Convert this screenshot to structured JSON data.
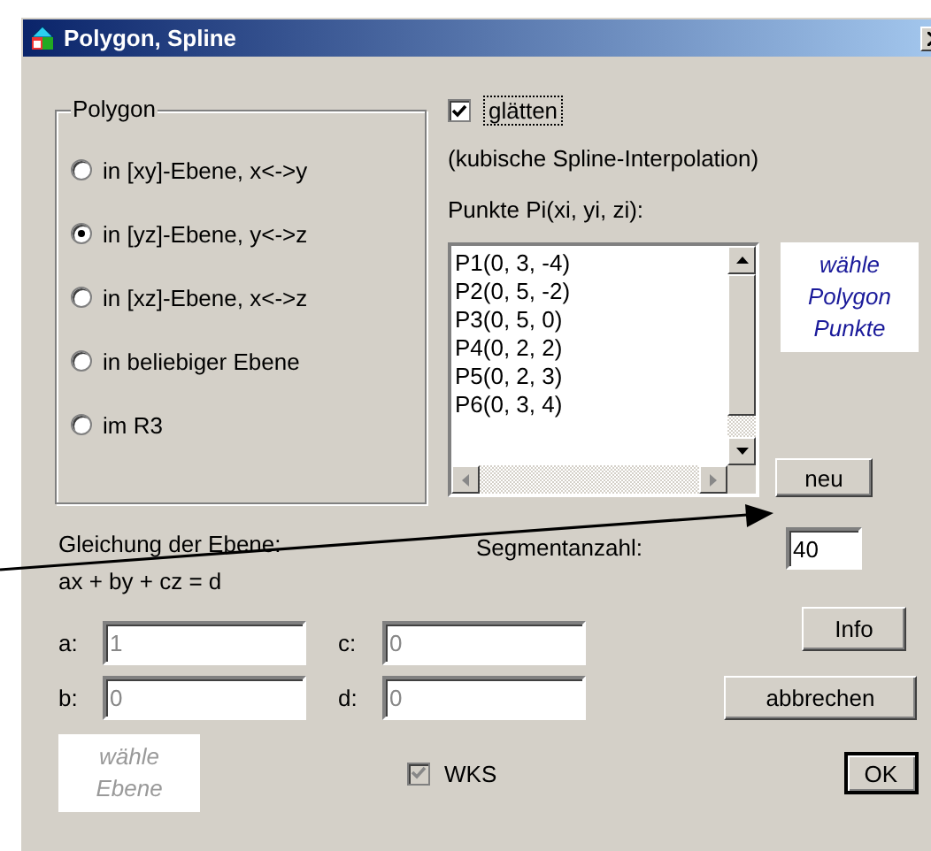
{
  "window": {
    "title": "Polygon, Spline"
  },
  "polygon_group": {
    "label": "Polygon",
    "options": [
      {
        "label": "in [xy]-Ebene, x<->y",
        "selected": false
      },
      {
        "label": "in [yz]-Ebene, y<->z",
        "selected": true
      },
      {
        "label": "in [xz]-Ebene, x<->z",
        "selected": false
      },
      {
        "label": "in beliebiger Ebene",
        "selected": false
      },
      {
        "label": "im R3",
        "selected": false
      }
    ]
  },
  "smooth": {
    "label": "glätten",
    "checked": true
  },
  "smooth_note": "(kubische Spline-Interpolation)",
  "points": {
    "label": "Punkte Pi(xi, yi, zi):",
    "items": [
      "P1(0, 3, -4)",
      "P2(0, 5, -2)",
      "P3(0, 5, 0)",
      "P4(0, 2, 2)",
      "P5(0, 2, 3)",
      "P6(0, 3, 4)"
    ]
  },
  "polygon_hint": {
    "lines": [
      "wähle",
      "Polygon",
      "Punkte"
    ],
    "disabled": false
  },
  "new_button": "neu",
  "plane_equation": {
    "title": "Gleichung der Ebene:",
    "formula": "ax + by + cz = d",
    "fields": [
      {
        "label": "a:",
        "value": "1",
        "disabled": true
      },
      {
        "label": "c:",
        "value": "0",
        "disabled": true
      },
      {
        "label": "b:",
        "value": "0",
        "disabled": true
      },
      {
        "label": "d:",
        "value": "0",
        "disabled": true
      }
    ]
  },
  "segments": {
    "label": "Segmentanzahl:",
    "value": "40"
  },
  "info_button": "Info",
  "cancel_button": "abbrechen",
  "plane_hint": {
    "lines": [
      "wähle",
      "Ebene"
    ],
    "disabled": true
  },
  "wks": {
    "label": "WKS",
    "checked": true,
    "disabled": true
  },
  "ok_button": {
    "label": "OK",
    "default": true
  }
}
